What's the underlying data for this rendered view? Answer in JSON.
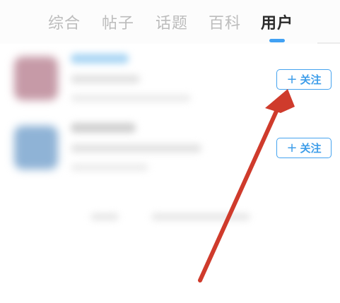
{
  "tabs": [
    {
      "label": "综合",
      "active": false
    },
    {
      "label": "帖子",
      "active": false
    },
    {
      "label": "话题",
      "active": false
    },
    {
      "label": "百科",
      "active": false
    },
    {
      "label": "用户",
      "active": true
    }
  ],
  "users": [
    {
      "follow_label": "关注",
      "follow_icon": "plus-icon"
    },
    {
      "follow_label": "关注",
      "follow_icon": "plus-icon"
    }
  ],
  "colors": {
    "accent": "#41a1f3",
    "arrow": "#cf3b2c",
    "tab_inactive": "#bcbcbc",
    "tab_active": "#2b2b2b"
  }
}
